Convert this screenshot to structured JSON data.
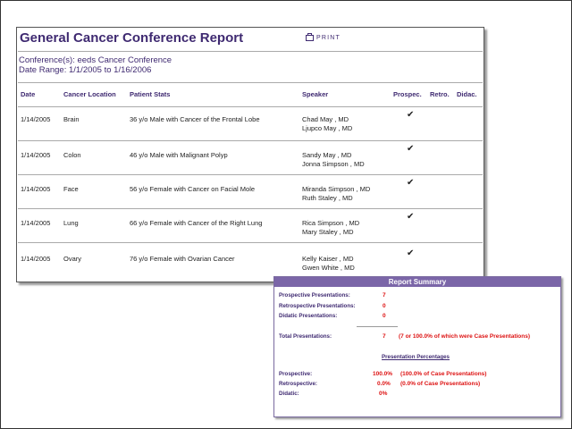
{
  "report": {
    "title": "General Cancer Conference Report",
    "print_label": "PRINT",
    "conference_line": "Conference(s): eeds Cancer Conference",
    "date_range_line": "Date Range: 1/1/2005 to 1/16/2006",
    "columns": {
      "date": "Date",
      "location": "Cancer Location",
      "stats": "Patient Stats",
      "speaker": "Speaker",
      "prospec": "Prospec.",
      "retro": "Retro.",
      "didac": "Didac."
    },
    "rows": [
      {
        "date": "1/14/2005",
        "location": "Brain",
        "stats": "36 y/o Male with Cancer of the Frontal Lobe",
        "speaker1": "Chad  May , MD",
        "speaker2": "Ljupco  May , MD",
        "prospec": "✔",
        "retro": "",
        "didac": ""
      },
      {
        "date": "1/14/2005",
        "location": "Colon",
        "stats": "46 y/o Male with Malignant Polyp",
        "speaker1": "Sandy  May , MD",
        "speaker2": "Jonna  Simpson , MD",
        "prospec": "✔",
        "retro": "",
        "didac": ""
      },
      {
        "date": "1/14/2005",
        "location": "Face",
        "stats": "56 y/o Female with Cancer on Facial Mole",
        "speaker1": "Miranda  Simpson , MD",
        "speaker2": "Ruth  Staley , MD",
        "prospec": "✔",
        "retro": "",
        "didac": ""
      },
      {
        "date": "1/14/2005",
        "location": "Lung",
        "stats": "66 y/o Female with Cancer of the Right Lung",
        "speaker1": "Rica  Simpson , MD",
        "speaker2": "Mary  Staley , MD",
        "prospec": "✔",
        "retro": "",
        "didac": ""
      },
      {
        "date": "1/14/2005",
        "location": "Ovary",
        "stats": "76 y/o Female with Ovarian Cancer",
        "speaker1": "Kelly  Kaiser , MD",
        "speaker2": "Gwen  White , MD",
        "prospec": "✔",
        "retro": "",
        "didac": ""
      }
    ]
  },
  "summary": {
    "title": "Report Summary",
    "prospective_label": "Prospective Presentations:",
    "prospective_value": "7",
    "retrospective_label": "Retrospective Presentations:",
    "retrospective_value": "0",
    "didatic_label": "Didatic Presentations:",
    "didatic_value": "0",
    "total_label": "Total Presentations:",
    "total_value": "7",
    "total_note": "(7 or 100.0% of which were Case Presentations)",
    "percentages_title": "Presentation Percentages",
    "pct_prospective_label": "Prospective:",
    "pct_prospective_value": "100.0%",
    "pct_prospective_note": "(100.0% of Case Presentations)",
    "pct_retrospective_label": "Retrospective:",
    "pct_retrospective_value": "0.0%",
    "pct_retrospective_note": "(0.0% of Case Presentations)",
    "pct_didatic_label": "Didatic:",
    "pct_didatic_value": "0%"
  },
  "colors": {
    "heading_purple": "#3f2a71",
    "summary_header": "#7b66a8",
    "value_red": "#dd1111"
  }
}
